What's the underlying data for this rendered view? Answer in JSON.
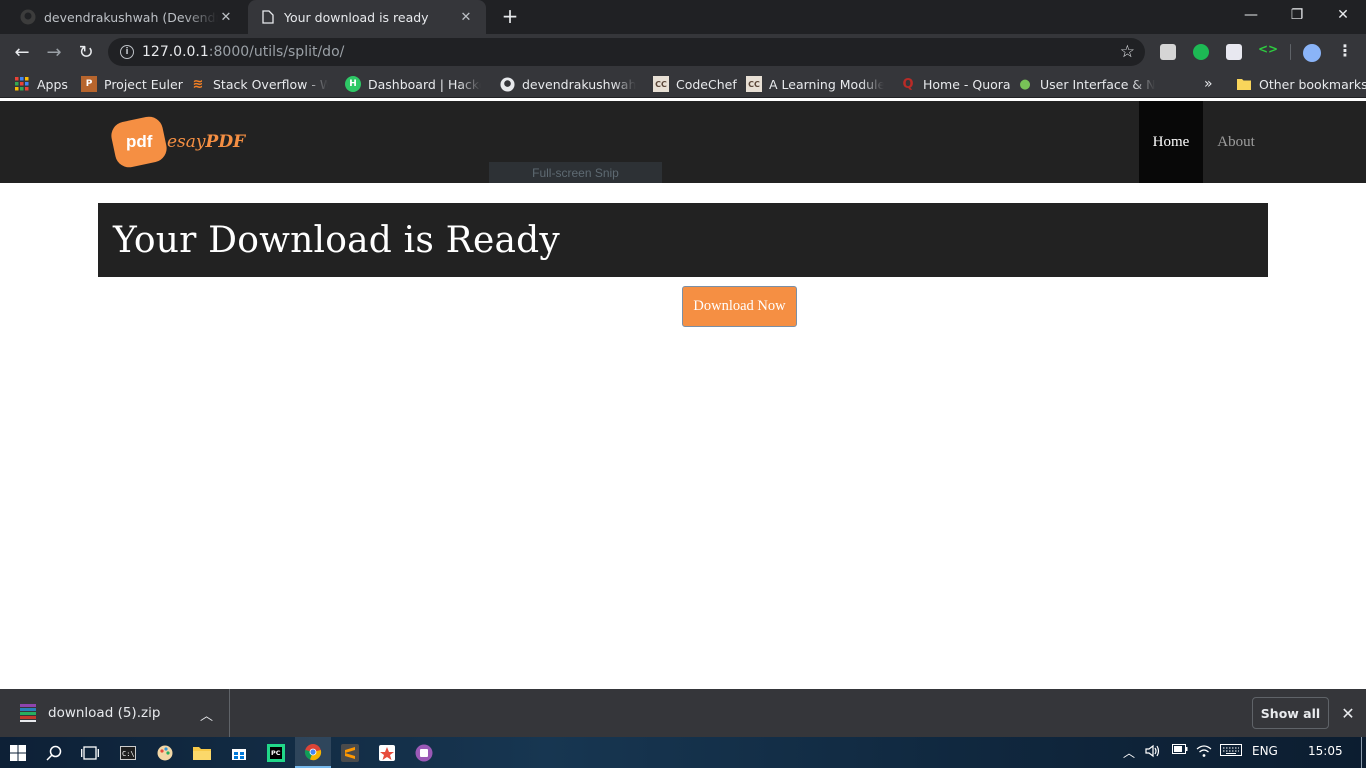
{
  "browser": {
    "tabs": [
      {
        "title": "devendrakushwah (Devendra Kushwah)",
        "active": false,
        "icon": "github-icon"
      },
      {
        "title": "Your download is ready",
        "active": true,
        "icon": "page-icon"
      }
    ],
    "url_host": "127.0.0.1",
    "url_path": ":8000/utils/split/do/",
    "bookmarks": [
      {
        "label": "Apps",
        "icon": "apps-grid-icon"
      },
      {
        "label": "Project Euler",
        "icon": "project-euler-icon"
      },
      {
        "label": "Stack Overflow - Whe",
        "icon": "stackoverflow-icon"
      },
      {
        "label": "Dashboard | HackerR",
        "icon": "hackerrank-icon"
      },
      {
        "label": "devendrakushwah · G",
        "icon": "github-icon"
      },
      {
        "label": "CodeChef",
        "icon": "codechef-icon"
      },
      {
        "label": "A Learning Module fo",
        "icon": "codechef-icon"
      },
      {
        "label": "Home - Quora",
        "icon": "quora-icon"
      },
      {
        "label": "User Interface & Navi",
        "icon": "android-icon"
      }
    ],
    "overflow": "»",
    "other_bookmarks": "Other bookmarks"
  },
  "site": {
    "logo_badge": "pdf",
    "logo_text_light": "esay",
    "logo_text_bold": "PDF",
    "nav": {
      "home": "Home",
      "about": "About"
    },
    "snip_tooltip": "Full-screen Snip",
    "heading": "Your Download is Ready",
    "download_button": "Download Now"
  },
  "download_shelf": {
    "filename": "download (5).zip",
    "show_all": "Show all"
  },
  "taskbar": {
    "language": "ENG",
    "time": "15:05"
  },
  "colors": {
    "accent": "#f58f43",
    "navbar": "#222222",
    "chrome_dark": "#202124",
    "chrome_toolbar": "#35363a"
  }
}
